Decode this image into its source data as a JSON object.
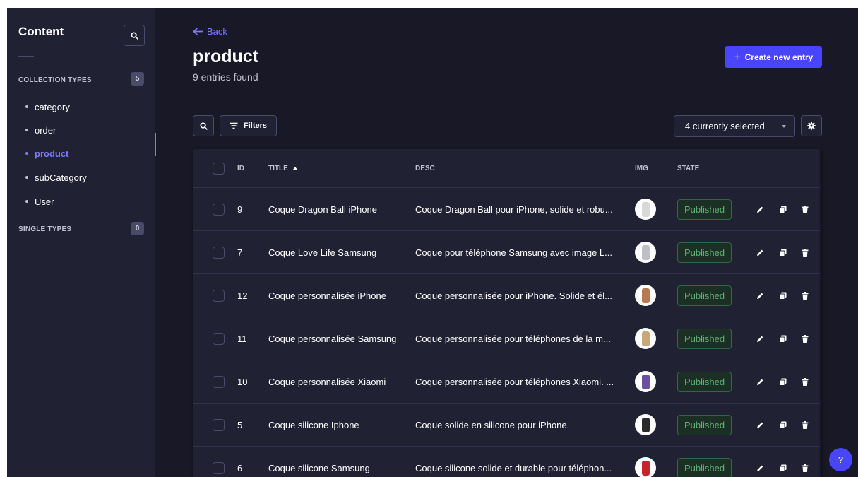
{
  "sidebar": {
    "title": "Content",
    "collection_types": {
      "label": "COLLECTION TYPES",
      "count": "5"
    },
    "items": [
      {
        "label": "category",
        "active": false
      },
      {
        "label": "order",
        "active": false
      },
      {
        "label": "product",
        "active": true
      },
      {
        "label": "subCategory",
        "active": false
      },
      {
        "label": "User",
        "active": false
      }
    ],
    "single_types": {
      "label": "SINGLE TYPES",
      "count": "0"
    }
  },
  "header": {
    "back_label": "Back",
    "title": "product",
    "subtitle": "9 entries found",
    "create_label": "Create new entry"
  },
  "toolbar": {
    "filters_label": "Filters",
    "columns_selected": "4 currently selected"
  },
  "table": {
    "columns": {
      "id": "ID",
      "title": "TITLE",
      "desc": "DESC",
      "img": "IMG",
      "state": "STATE"
    },
    "rows": [
      {
        "id": "9",
        "title": "Coque Dragon Ball iPhone",
        "desc": "Coque Dragon Ball pour iPhone, solide et robu...",
        "state": "Published",
        "img_color": "#d8d8d8"
      },
      {
        "id": "7",
        "title": "Coque Love Life Samsung",
        "desc": "Coque pour téléphone Samsung avec image L...",
        "state": "Published",
        "img_color": "#bfbfc6"
      },
      {
        "id": "12",
        "title": "Coque personnalisée iPhone",
        "desc": "Coque personnalisée pour iPhone. Solide et él...",
        "state": "Published",
        "img_color": "#b97a52"
      },
      {
        "id": "11",
        "title": "Coque personnalisée Samsung",
        "desc": "Coque personnalisée pour téléphones de la m...",
        "state": "Published",
        "img_color": "#c9a877"
      },
      {
        "id": "10",
        "title": "Coque personnalisée Xiaomi",
        "desc": "Coque personnalisée pour téléphones Xiaomi. ...",
        "state": "Published",
        "img_color": "#6b4fa0"
      },
      {
        "id": "5",
        "title": "Coque silicone Iphone",
        "desc": "Coque solide en silicone pour iPhone.",
        "state": "Published",
        "img_color": "#2b2b2b"
      },
      {
        "id": "6",
        "title": "Coque silicone Samsung",
        "desc": "Coque silicone solide et durable pour téléphon...",
        "state": "Published",
        "img_color": "#c8242e"
      }
    ]
  },
  "help": {
    "label": "?"
  },
  "colors": {
    "accent": "#4945ff",
    "accent_text": "#7b79ff",
    "published": "#5cb176"
  }
}
